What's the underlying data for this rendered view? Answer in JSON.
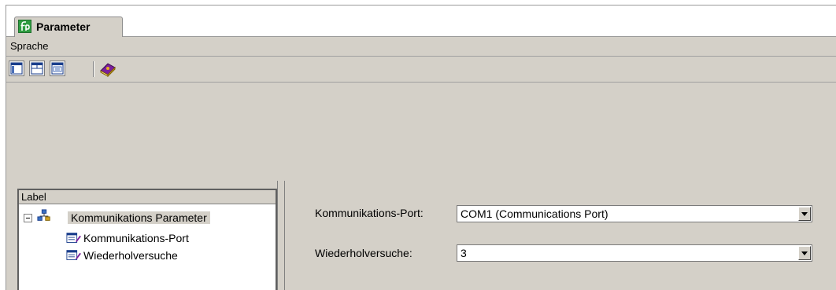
{
  "window": {
    "tab": {
      "label": "Parameter",
      "icon": "pepperl-fuchs-logo-icon"
    }
  },
  "menubar": {
    "items": [
      {
        "label": "Sprache"
      }
    ]
  },
  "toolbar": {
    "buttons": [
      {
        "icon": "layout-left-pane-icon"
      },
      {
        "icon": "layout-top-pane-icon"
      },
      {
        "icon": "layout-split-pane-icon"
      },
      {
        "icon": "help-book-icon"
      }
    ]
  },
  "tree": {
    "header": "Label",
    "root": {
      "label": "Kommunikations Parameter",
      "icon": "network-folder-icon",
      "expanded": true
    },
    "children": [
      {
        "label": "Kommunikations-Port",
        "icon": "parameter-edit-icon"
      },
      {
        "label": "Wiederholversuche",
        "icon": "parameter-edit-icon"
      }
    ]
  },
  "params": {
    "port": {
      "label": "Kommunikations-Port:",
      "value": "COM1 (Communications Port)"
    },
    "retries": {
      "label": "Wiederholversuche:",
      "value": "3"
    }
  }
}
